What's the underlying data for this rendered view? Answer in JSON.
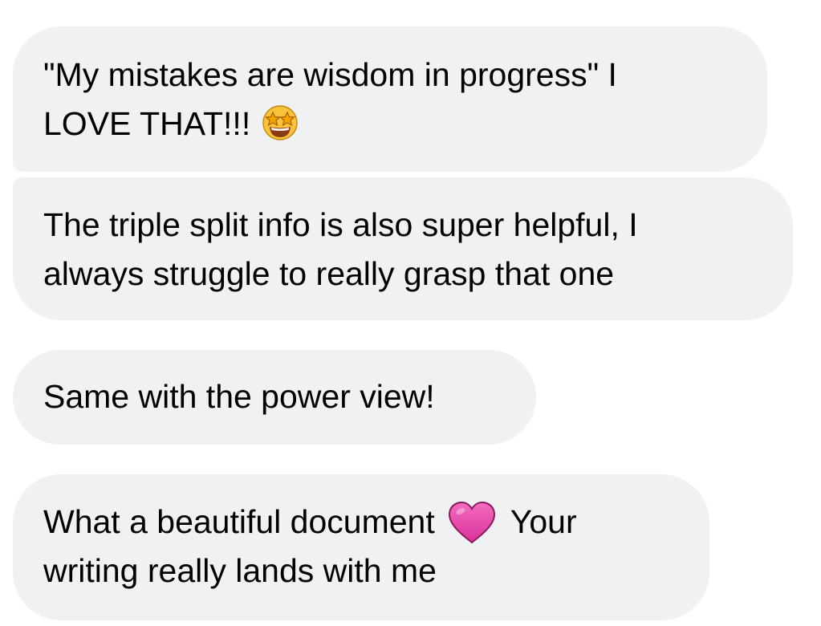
{
  "messages": [
    {
      "lines": [
        "\"My mistakes are wisdom in progress\" I",
        "LOVE THAT!!!"
      ],
      "emoji": "star-struck-emoji"
    },
    {
      "lines": [
        "The triple split info is also super helpful, I",
        "always struggle to really grasp that one"
      ]
    },
    {
      "lines": [
        "Same with the power view!"
      ]
    },
    {
      "line1_before_emoji": "What a beautiful document",
      "emoji": "pink-heart-emoji",
      "line1_after_emoji": "Your",
      "line2": "writing really lands with me"
    }
  ],
  "colors": {
    "bubble_background": "#eff1f3",
    "text": "#000000",
    "heart": "#ee4fa9",
    "star_face": "#f9c33b",
    "star_eyes": "#f2a300"
  }
}
